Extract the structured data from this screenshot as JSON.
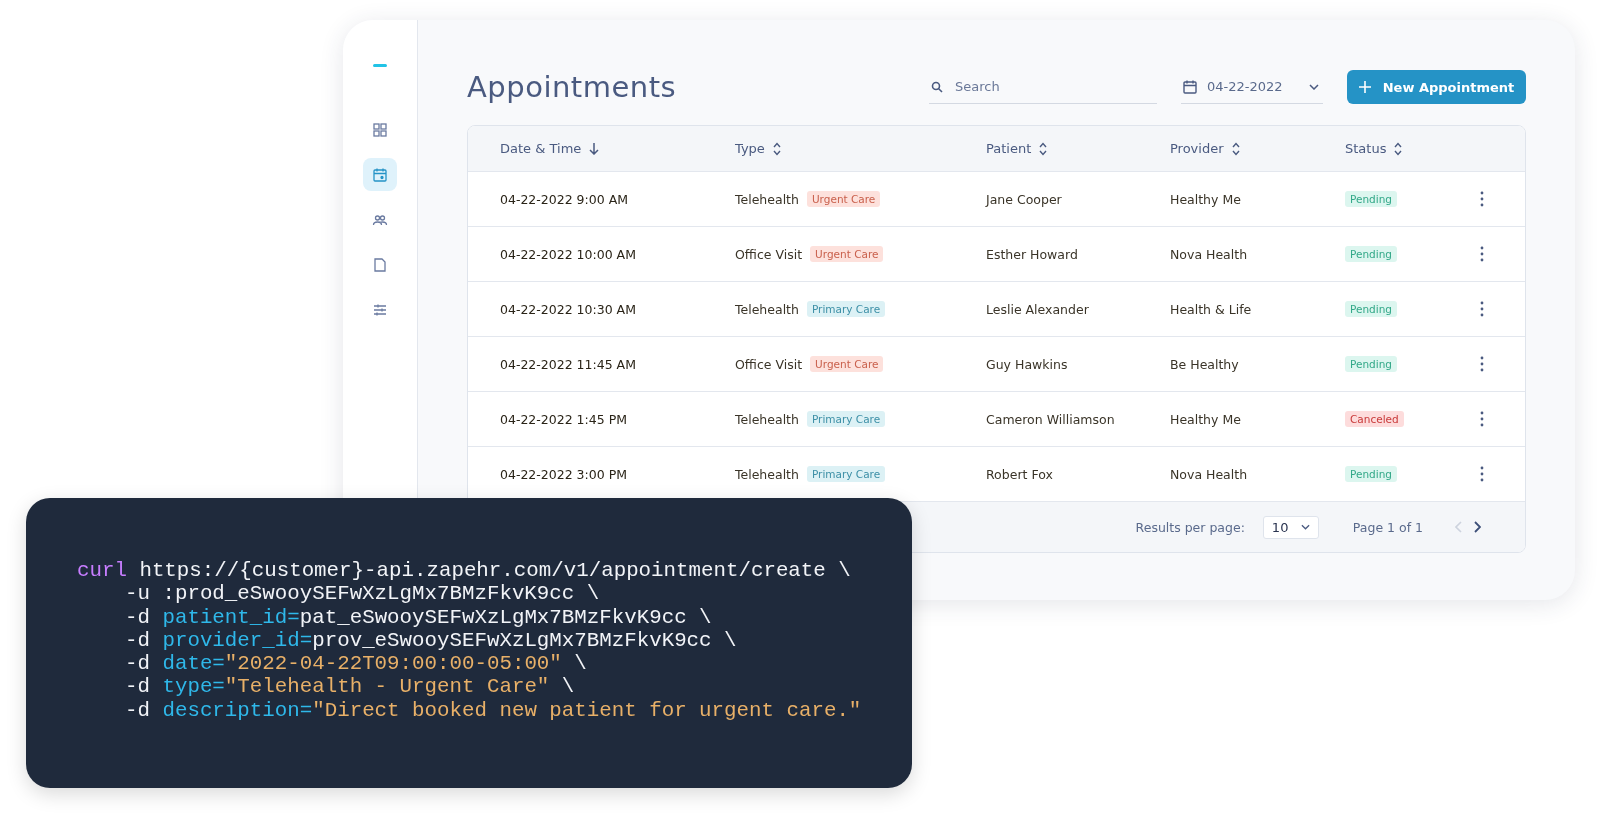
{
  "sidebar": {
    "items": [
      {
        "selected": false
      },
      {
        "selected": true
      },
      {
        "selected": false
      },
      {
        "selected": false
      },
      {
        "selected": false
      }
    ]
  },
  "header": {
    "title": "Appointments",
    "search": {
      "placeholder": "Search"
    },
    "date_field": {
      "value": "04-22-2022"
    },
    "new_button": {
      "label": "New Appointment"
    }
  },
  "table": {
    "columns": [
      {
        "label": "Date & Time",
        "sorted": true
      },
      {
        "label": "Type",
        "sorted": false
      },
      {
        "label": "Patient",
        "sorted": false
      },
      {
        "label": "Provider",
        "sorted": false
      },
      {
        "label": "Status",
        "sorted": false
      }
    ],
    "rows": [
      {
        "datetime": "04-22-2022 9:00 AM",
        "type": "Telehealth",
        "tag": {
          "label": "Urgent Care",
          "kind": "urgent"
        },
        "patient": "Jane Cooper",
        "provider": "Healthy Me",
        "status": {
          "label": "Pending",
          "kind": "pending"
        }
      },
      {
        "datetime": "04-22-2022 10:00 AM",
        "type": "Office Visit",
        "tag": {
          "label": "Urgent Care",
          "kind": "urgent"
        },
        "patient": "Esther Howard",
        "provider": "Nova Health",
        "status": {
          "label": "Pending",
          "kind": "pending"
        }
      },
      {
        "datetime": "04-22-2022 10:30 AM",
        "type": "Telehealth",
        "tag": {
          "label": "Primary Care",
          "kind": "primary"
        },
        "patient": "Leslie Alexander",
        "provider": "Health & Life",
        "status": {
          "label": "Pending",
          "kind": "pending"
        }
      },
      {
        "datetime": "04-22-2022 11:45 AM",
        "type": "Office Visit",
        "tag": {
          "label": "Urgent Care",
          "kind": "urgent"
        },
        "patient": "Guy Hawkins",
        "provider": "Be Healthy",
        "status": {
          "label": "Pending",
          "kind": "pending"
        }
      },
      {
        "datetime": "04-22-2022 1:45 PM",
        "type": "Telehealth",
        "tag": {
          "label": "Primary Care",
          "kind": "primary"
        },
        "patient": "Cameron Williamson",
        "provider": "Healthy Me",
        "status": {
          "label": "Canceled",
          "kind": "canceled"
        }
      },
      {
        "datetime": "04-22-2022 3:00 PM",
        "type": "Telehealth",
        "tag": {
          "label": "Primary Care",
          "kind": "primary"
        },
        "patient": "Robert Fox",
        "provider": "Nova Health",
        "status": {
          "label": "Pending",
          "kind": "pending"
        }
      }
    ],
    "footer": {
      "results_label": "Results per page:",
      "per_page": "10",
      "page_info": "Page 1 of 1"
    }
  },
  "code": {
    "lines": [
      {
        "segments": [
          {
            "kind": "command",
            "text": "curl"
          },
          {
            "kind": "plain",
            "text": " https://{customer}-api.zapehr.com/v1/appointment/create \\"
          }
        ]
      },
      {
        "segments": [
          {
            "kind": "plain",
            "text": "-u :prod_eSwooySEFwXzLgMx7BMzFkvK9cc \\"
          }
        ]
      },
      {
        "segments": [
          {
            "kind": "plain",
            "text": "-d "
          },
          {
            "kind": "key",
            "text": "patient_id="
          },
          {
            "kind": "plain",
            "text": "pat_eSwooySEFwXzLgMx7BMzFkvK9cc \\"
          }
        ]
      },
      {
        "segments": [
          {
            "kind": "plain",
            "text": "-d "
          },
          {
            "kind": "key",
            "text": "provider_id="
          },
          {
            "kind": "plain",
            "text": "prov_eSwooySEFwXzLgMx7BMzFkvK9cc \\"
          }
        ]
      },
      {
        "segments": [
          {
            "kind": "plain",
            "text": "-d "
          },
          {
            "kind": "key",
            "text": "date="
          },
          {
            "kind": "string",
            "text": "\"2022-04-22T09:00:00-05:00\""
          },
          {
            "kind": "plain",
            "text": " \\"
          }
        ]
      },
      {
        "segments": [
          {
            "kind": "plain",
            "text": "-d "
          },
          {
            "kind": "key",
            "text": "type="
          },
          {
            "kind": "string",
            "text": "\"Telehealth - Urgent Care\""
          },
          {
            "kind": "plain",
            "text": " \\"
          }
        ]
      },
      {
        "segments": [
          {
            "kind": "plain",
            "text": "-d "
          },
          {
            "kind": "key",
            "text": "description="
          },
          {
            "kind": "string",
            "text": "\"Direct booked new patient for urgent care.\""
          }
        ]
      }
    ]
  }
}
